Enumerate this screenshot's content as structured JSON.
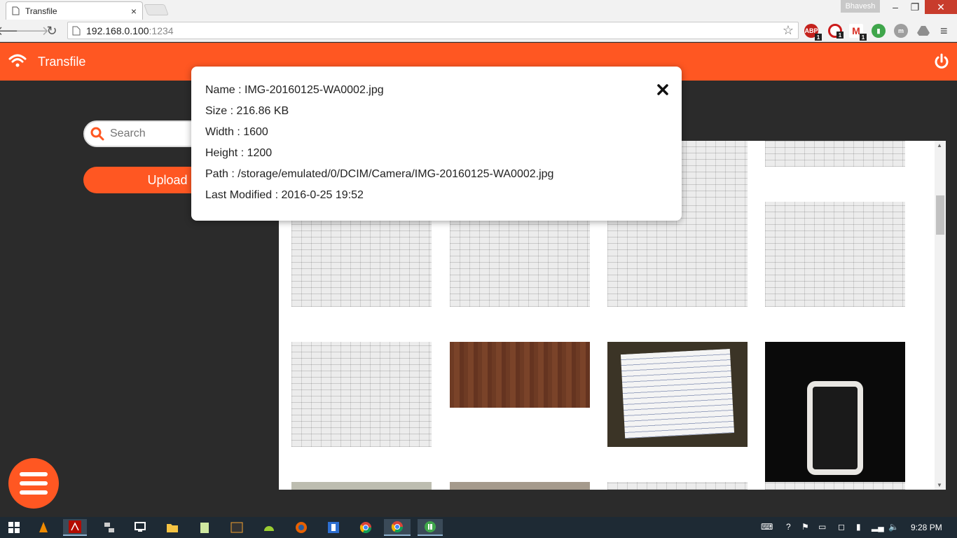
{
  "browser": {
    "tab_title": "Transfile",
    "tab_close": "×",
    "user_name": "Bhavesh",
    "url_host": "192.168.0.100",
    "url_port": ":1234",
    "win_min": "–",
    "win_max": "❐",
    "win_close": "✕",
    "extensions": [
      {
        "name": "ABP",
        "badge": "1",
        "color": "#c4211b"
      },
      {
        "name": "opera",
        "badge": "1",
        "color": "#cc1b1b"
      },
      {
        "name": "gmail",
        "badge": "1",
        "color": "#d93025"
      },
      {
        "name": "pushbullet",
        "badge": "",
        "color": "#3fa64b"
      },
      {
        "name": "m",
        "badge": "",
        "color": "#9e9e9e"
      },
      {
        "name": "drive",
        "badge": "",
        "color": "#9e9e9e"
      }
    ]
  },
  "app": {
    "title": "Transfile",
    "accent": "#ff5722"
  },
  "sidebar": {
    "search_placeholder": "Search",
    "upload_label": "Upload"
  },
  "gallery": {
    "items": [
      {
        "kind": "paper"
      },
      {
        "kind": "paper"
      },
      {
        "kind": "paper"
      },
      {
        "kind": "paper"
      },
      {
        "kind": "paper"
      },
      {
        "kind": "wood"
      },
      {
        "kind": "notes"
      },
      {
        "kind": "phone"
      }
    ]
  },
  "modal": {
    "name": "Name : IMG-20160125-WA0002.jpg",
    "size": "Size : 216.86 KB",
    "width": "Width : 1600",
    "height": "Height : 1200",
    "path": "Path : /storage/emulated/0/DCIM/Camera/IMG-20160125-WA0002.jpg",
    "modified": "Last Modified : 2016-0-25 19:52"
  },
  "taskbar": {
    "clock": "9:28 PM"
  }
}
